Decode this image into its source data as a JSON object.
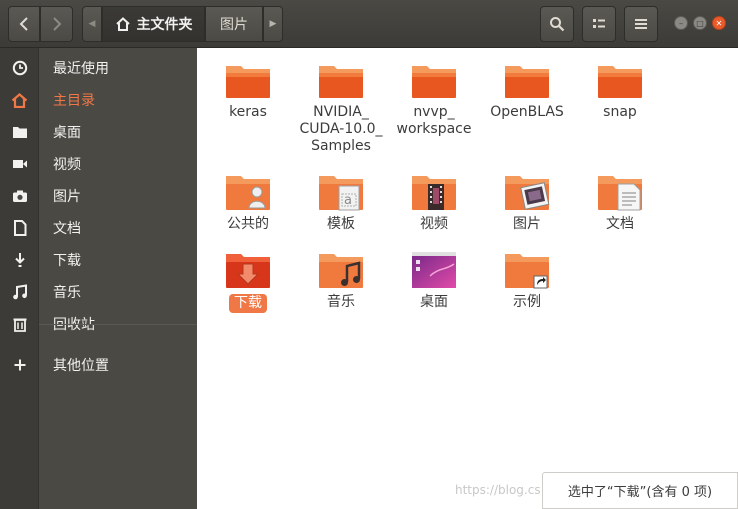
{
  "header": {
    "breadcrumb_home": "主文件夹",
    "breadcrumb_current": "图片"
  },
  "sidebar": {
    "items": [
      {
        "label": "最近使用",
        "icon": "clock-icon"
      },
      {
        "label": "主目录",
        "icon": "home-icon",
        "active": true
      },
      {
        "label": "桌面",
        "icon": "folder-icon"
      },
      {
        "label": "视频",
        "icon": "video-icon"
      },
      {
        "label": "图片",
        "icon": "camera-icon"
      },
      {
        "label": "文档",
        "icon": "document-icon"
      },
      {
        "label": "下载",
        "icon": "download-icon"
      },
      {
        "label": "音乐",
        "icon": "music-icon"
      },
      {
        "label": "回收站",
        "icon": "trash-icon"
      }
    ],
    "other_locations": "其他位置"
  },
  "folders": {
    "keras": "keras",
    "nvidia": "NVIDIA_\nCUDA-10.0_\nSamples",
    "nvvp": "nvvp_\nworkspace",
    "openblas": "OpenBLAS",
    "snap": "snap",
    "public": "公共的",
    "templates": "模板",
    "videos": "视频",
    "pictures": "图片",
    "documents": "文档",
    "downloads": "下载",
    "music": "音乐",
    "desktop": "桌面",
    "examples": "示例"
  },
  "status": {
    "text": "选中了“下载”(含有 0 项)"
  },
  "watermark": "https://blog.cs",
  "colors": {
    "accent": "#f07746",
    "folder_top": "#f49a5d",
    "folder_body": "#e8571f"
  }
}
